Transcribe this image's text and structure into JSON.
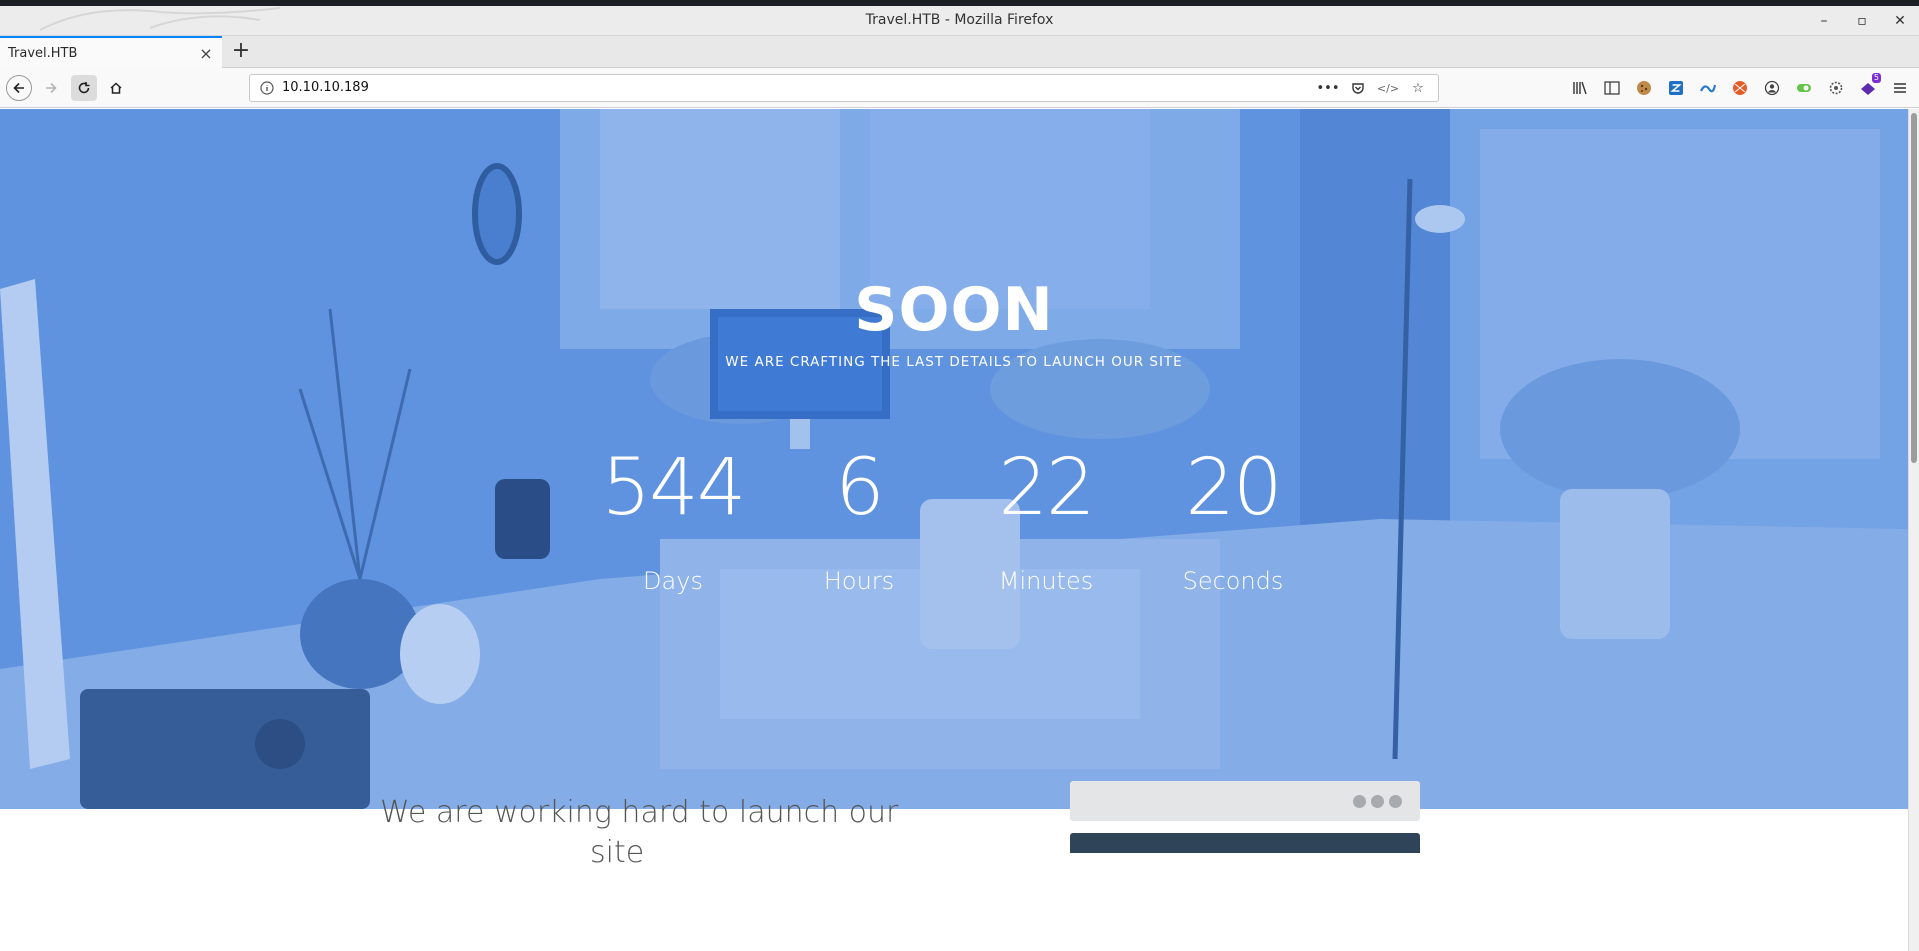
{
  "window": {
    "title": "Travel.HTB - Mozilla Firefox",
    "controls": [
      "minimize-icon",
      "maximize-icon",
      "close-icon"
    ]
  },
  "tabs": [
    {
      "label": "Travel.HTB",
      "active": true
    }
  ],
  "navigation": {
    "url": "10.10.10.189",
    "toolbar_icons": [
      "library-icon",
      "sidebar-icon",
      "cookie-icon",
      "extension-z-icon",
      "extension-icon",
      "extension-ball-icon",
      "account-icon",
      "extension-green-icon",
      "settings-icon",
      "extension-purple-icon",
      "menu-icon"
    ],
    "extension_badge": "5"
  },
  "hero": {
    "headline": "SOON",
    "tagline": "WE ARE CRAFTING THE LAST DETAILS TO LAUNCH OUR SITE",
    "overlay_color": "#4a86dc",
    "countdown": [
      {
        "value": "544",
        "label": "Days"
      },
      {
        "value": "6",
        "label": "Hours"
      },
      {
        "value": "22",
        "label": "Minutes"
      },
      {
        "value": "20",
        "label": "Seconds"
      }
    ]
  },
  "section": {
    "heading_line1": "We are working hard to launch our",
    "heading_line2": "site"
  }
}
